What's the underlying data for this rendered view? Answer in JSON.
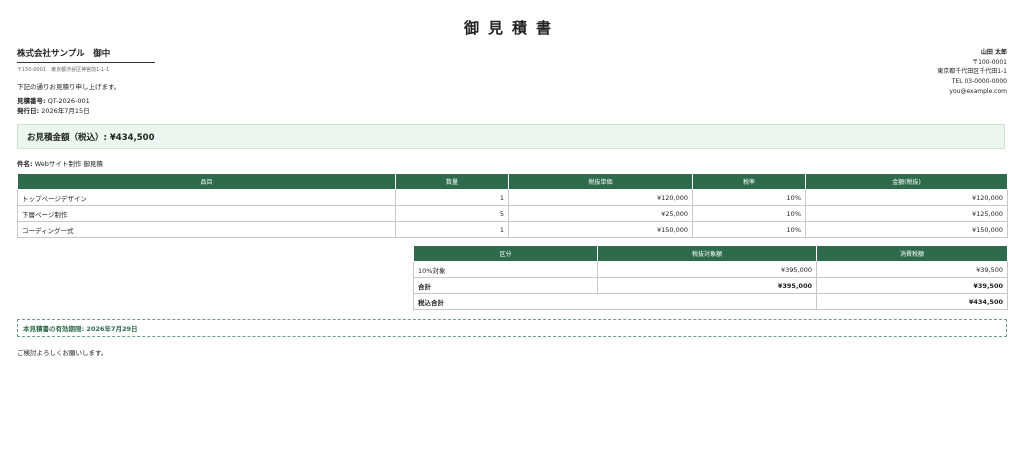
{
  "document": {
    "title": "御見積書"
  },
  "recipient": {
    "name": "株式会社サンプル　御中",
    "address": "〒150-0001　東京都渋谷区神宮前1-1-1"
  },
  "intro": "下記の通りお見積り申し上げます。",
  "meta": {
    "quote_number_label": "見積番号:",
    "quote_number": "QT-2026-001",
    "issue_date_label": "発行日:",
    "issue_date": "2026年7月15日"
  },
  "sender": {
    "name": "山田 太郎",
    "postal": "〒100-0001",
    "address": "東京都千代田区千代田1-1",
    "tel": "TEL 03-0000-0000",
    "email": "you@example.com"
  },
  "total": {
    "text": "お見積金額（税込）: ¥434,500"
  },
  "subject": {
    "label": "件名:",
    "value": "Webサイト制作 御見積"
  },
  "items_table": {
    "headers": [
      "品目",
      "数量",
      "税抜単価",
      "税率",
      "金額(税抜)"
    ],
    "rows": [
      [
        "トップページデザイン",
        "1",
        "¥120,000",
        "10%",
        "¥120,000"
      ],
      [
        "下層ページ制作",
        "5",
        "¥25,000",
        "10%",
        "¥125,000"
      ],
      [
        "コーディング一式",
        "1",
        "¥150,000",
        "10%",
        "¥150,000"
      ]
    ]
  },
  "tax_table": {
    "headers": [
      "区分",
      "税抜対象額",
      "消費税額"
    ],
    "rows": [
      [
        "10%対象",
        "¥395,000",
        "¥39,500"
      ],
      [
        "合計",
        "¥395,000",
        "¥39,500"
      ]
    ],
    "grand_total_label": "税込合計",
    "grand_total_value": "¥434,500"
  },
  "validity": "本見積書の有効期限: 2026年7月29日",
  "closing": "ご検討よろしくお願いします。"
}
